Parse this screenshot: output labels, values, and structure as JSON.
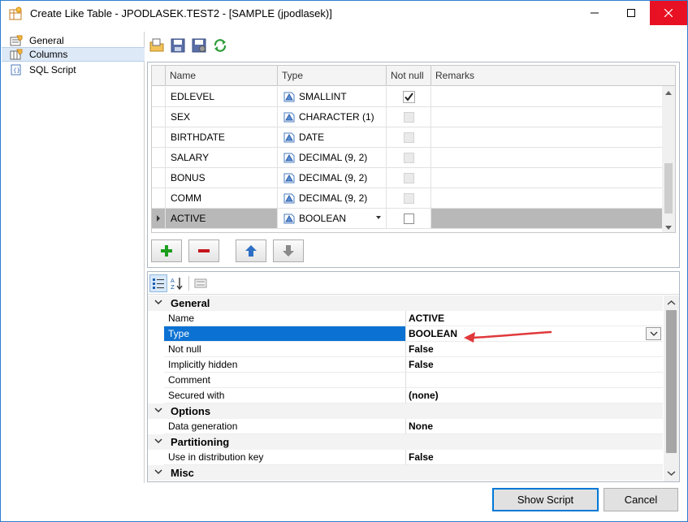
{
  "window": {
    "title": "Create Like Table - JPODLASEK.TEST2 - [SAMPLE (jpodlasek)]",
    "icon": "table-wizard-icon"
  },
  "nav": {
    "items": [
      {
        "label": "General",
        "icon": "properties-icon",
        "selected": false
      },
      {
        "label": "Columns",
        "icon": "columns-icon",
        "selected": true
      },
      {
        "label": "SQL Script",
        "icon": "sql-script-icon",
        "selected": false
      }
    ]
  },
  "grid": {
    "headers": {
      "name": "Name",
      "type": "Type",
      "not_null": "Not null",
      "remarks": "Remarks"
    },
    "rows": [
      {
        "name": "EDLEVEL",
        "type": "SMALLINT",
        "not_null": true,
        "remarks": ""
      },
      {
        "name": "SEX",
        "type": "CHARACTER (1)",
        "not_null": false,
        "remarks": ""
      },
      {
        "name": "BIRTHDATE",
        "type": "DATE",
        "not_null": false,
        "remarks": ""
      },
      {
        "name": "SALARY",
        "type": "DECIMAL (9, 2)",
        "not_null": false,
        "remarks": ""
      },
      {
        "name": "BONUS",
        "type": "DECIMAL (9, 2)",
        "not_null": false,
        "remarks": ""
      },
      {
        "name": "COMM",
        "type": "DECIMAL (9, 2)",
        "not_null": false,
        "remarks": ""
      },
      {
        "name": "ACTIVE",
        "type": "BOOLEAN",
        "not_null": false,
        "remarks": ""
      }
    ]
  },
  "properties": {
    "categories": {
      "general": "General",
      "options": "Options",
      "partitioning": "Partitioning",
      "misc": "Misc"
    },
    "rows": {
      "name": {
        "label": "Name",
        "value": "ACTIVE"
      },
      "type": {
        "label": "Type",
        "value": "BOOLEAN"
      },
      "not_null": {
        "label": "Not null",
        "value": "False"
      },
      "implicitly_hidden": {
        "label": "Implicitly hidden",
        "value": "False"
      },
      "comment": {
        "label": "Comment",
        "value": ""
      },
      "secured_with": {
        "label": "Secured with",
        "value": "(none)"
      },
      "data_generation": {
        "label": "Data generation",
        "value": "None"
      },
      "distribution_key": {
        "label": "Use in distribution key",
        "value": "False"
      }
    }
  },
  "footer": {
    "show_script": "Show Script",
    "cancel": "Cancel"
  },
  "colors": {
    "selection": "#0b72d3",
    "close_button": "#e81123",
    "annotation_arrow": "#e0393b",
    "add_green": "#1e9e1e",
    "remove_red": "#c4151b",
    "move_blue": "#2d6fc4"
  }
}
